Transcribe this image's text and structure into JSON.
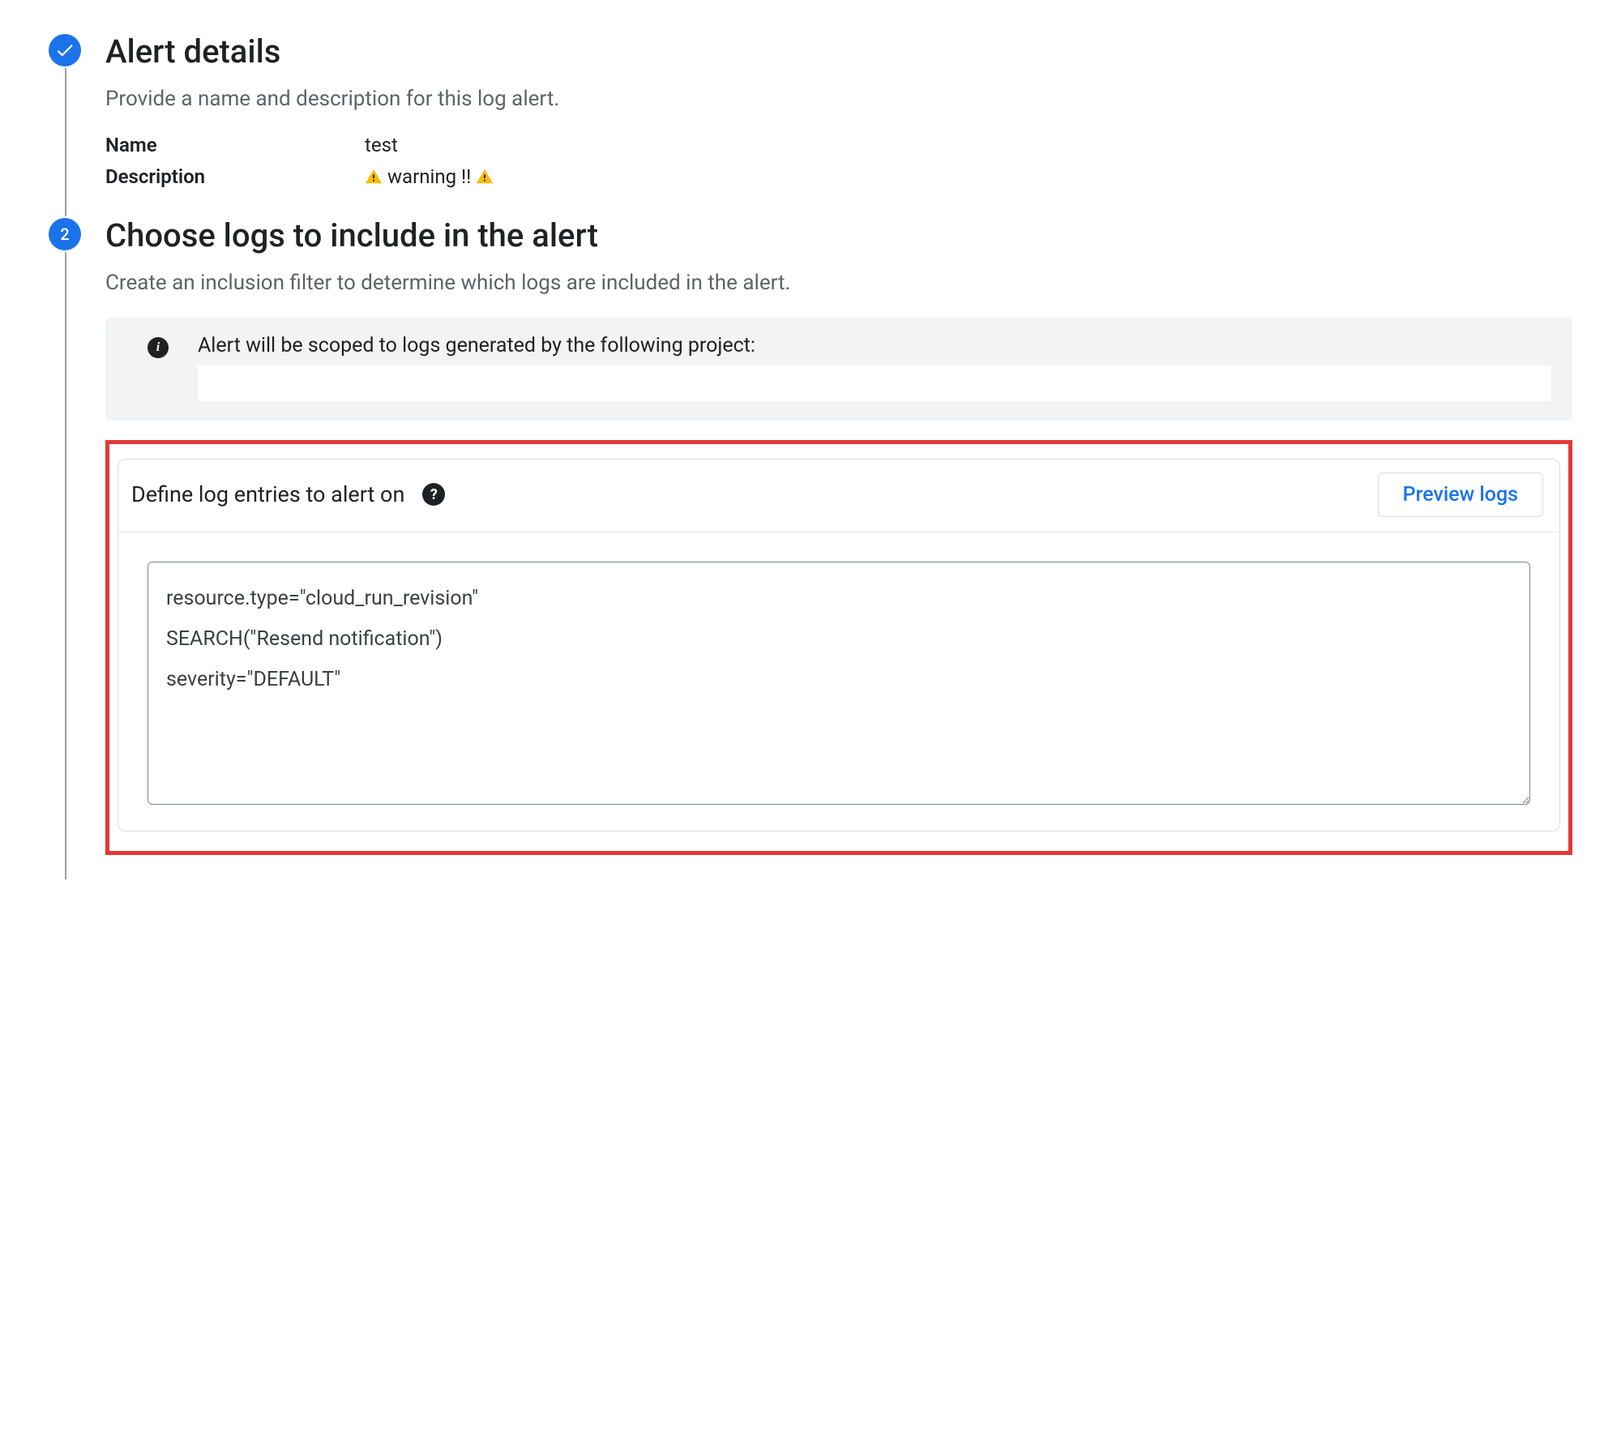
{
  "step1": {
    "title": "Alert details",
    "subtitle": "Provide a name and description for this log alert.",
    "name_label": "Name",
    "name_value": "test",
    "description_label": "Description",
    "description_value": "warning !!"
  },
  "step2": {
    "number": "2",
    "title": "Choose logs to include in the alert",
    "subtitle": "Create an inclusion filter to determine which logs are included in the alert.",
    "info_text": "Alert will be scoped to logs generated by the following project:",
    "card_title": "Define log entries to alert on",
    "preview_button": "Preview logs",
    "log_query": "resource.type=\"cloud_run_revision\"\nSEARCH(\"Resend notification\")\nseverity=\"DEFAULT\""
  }
}
